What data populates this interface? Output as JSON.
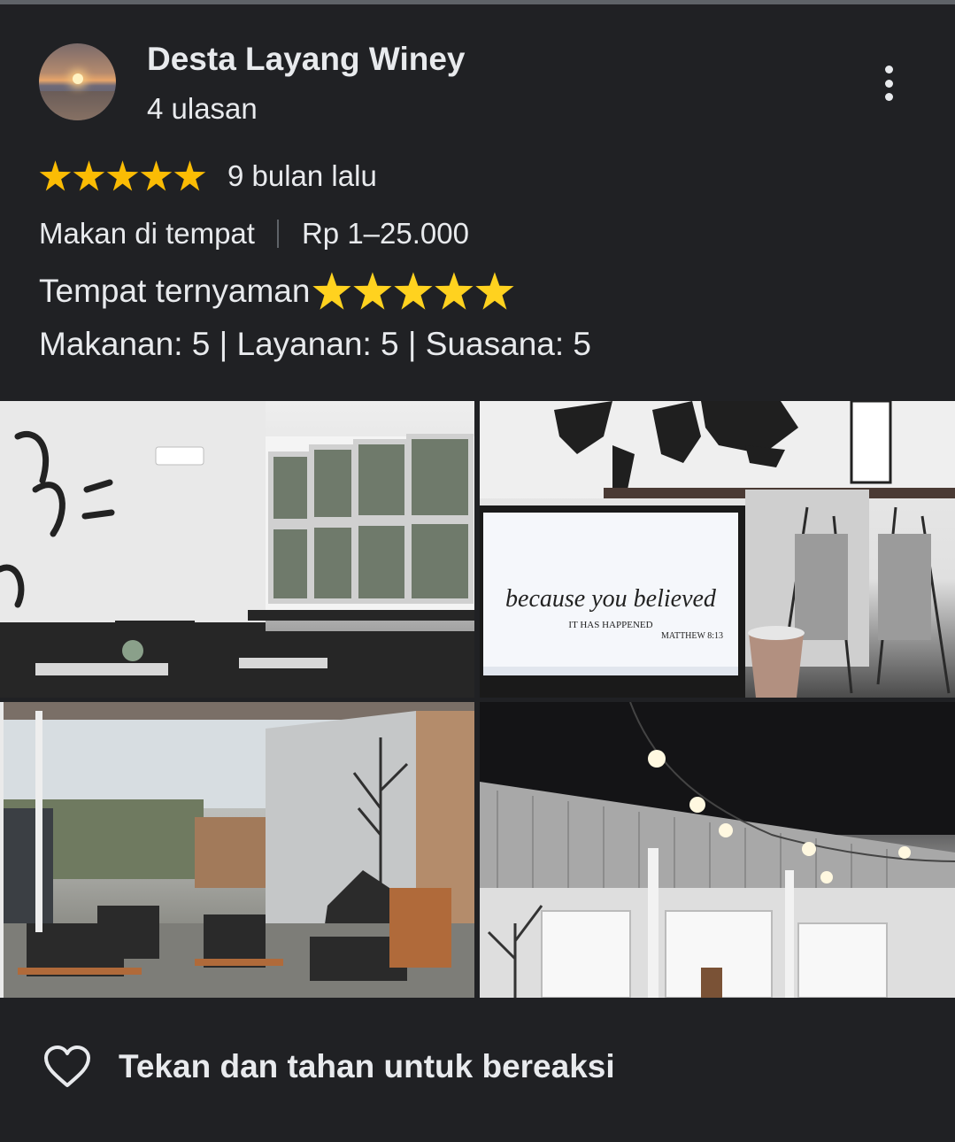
{
  "review": {
    "author_name": "Desta Layang Winey",
    "review_count": "4 ulasan",
    "rating_stars": 5,
    "time_ago": "9 bulan lalu",
    "service_type": "Makan di tempat",
    "price_range": "Rp 1–25.000",
    "text": "Tempat ternyaman",
    "text_emoji_stars": 5,
    "subratings": "Makanan: 5 | Layanan: 5 | Suasana: 5"
  },
  "icons": {
    "more": "more-vert-icon",
    "star": "star-icon",
    "like": "heart-outline-icon"
  },
  "actions": {
    "react_label": "Tekan dan tahan untuk bereaksi"
  },
  "colors": {
    "background": "#202124",
    "text": "#e8eaed",
    "star": "#fbbc04",
    "divider": "#5f6368"
  }
}
